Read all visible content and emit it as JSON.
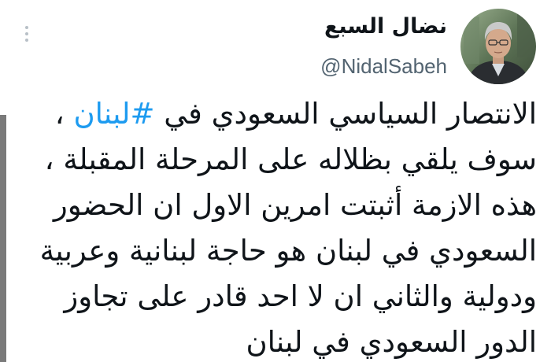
{
  "tweet": {
    "author": {
      "display_name": "نضال السبع",
      "handle": "@NidalSabeh",
      "avatar_icon": "profile-photo"
    },
    "menu_icon": "more-vertical-icon",
    "body": {
      "line1_before": "الانتصار السياسي السعودي في ",
      "hashtag": "#لبنان",
      "line1_after": " ،",
      "line2": "سوف يلقي بظلاله على المرحلة المقبلة ،",
      "line3": "هذه الازمة أثبتت امرين الاول ان الحضور",
      "line4": "السعودي في لبنان هو حاجة لبنانية وعربية",
      "line5": "ودولية والثاني ان لا احد قادر على تجاوز",
      "line6": "الدور السعودي في لبنان"
    },
    "colors": {
      "text": "#0f1419",
      "secondary": "#536471",
      "link": "#1d9bf0"
    }
  }
}
